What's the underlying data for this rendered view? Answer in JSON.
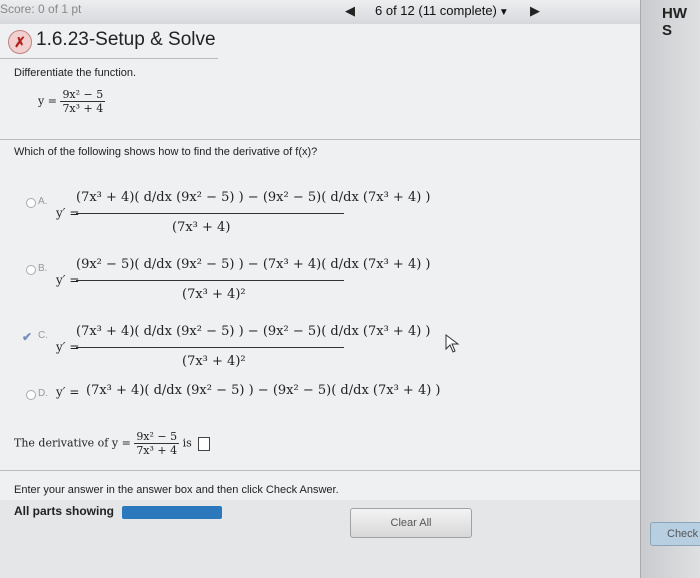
{
  "header": {
    "brand": "Score: 0 of 1 pt",
    "progress": "6 of 12 (11 complete)",
    "hw_label": "HW S"
  },
  "question": {
    "id_title": "1.6.23-Setup & Solve",
    "instruction": "Differentiate the function.",
    "function_lhs": "y =",
    "function_num": "9x² − 5",
    "function_den": "7x³ + 4",
    "prompt": "Which of the following shows how to find the derivative of f(x)?"
  },
  "options": [
    {
      "letter": "A.",
      "lhs": "y′ =",
      "numerator": "(7x³ + 4)( d/dx (9x² − 5) ) − (9x² − 5)( d/dx (7x³ + 4) )",
      "denominator": "(7x³ + 4)",
      "selected": false
    },
    {
      "letter": "B.",
      "lhs": "y′ =",
      "numerator": "(9x² − 5)( d/dx (9x² − 5) ) − (7x³ + 4)( d/dx (7x³ + 4) )",
      "denominator": "(7x³ + 4)²",
      "selected": false
    },
    {
      "letter": "C.",
      "lhs": "y′ =",
      "numerator": "(7x³ + 4)( d/dx (9x² − 5) ) − (9x² − 5)( d/dx (7x³ + 4) )",
      "denominator": "(7x³ + 4)²",
      "selected": true
    },
    {
      "letter": "D.",
      "lhs": "y′ =",
      "numerator": "(7x³ + 4)( d/dx (9x² − 5) ) − (9x² − 5)( d/dx (7x³ + 4) )",
      "denominator": "",
      "selected": false
    }
  ],
  "derivative_prompt": {
    "lead": "The derivative of y =",
    "num": "9x² − 5",
    "den": "7x³ + 4",
    "tail": "is"
  },
  "footer": {
    "enter_text": "Enter your answer in the answer box and then click Check Answer.",
    "parts_label": "All parts showing",
    "clear_label": "Clear All",
    "check_label": "Check Answer"
  },
  "colors": {
    "parts_bar": "#2b78bd",
    "status_incorrect": "#b42121",
    "correct_check": "#7c8fbd"
  }
}
